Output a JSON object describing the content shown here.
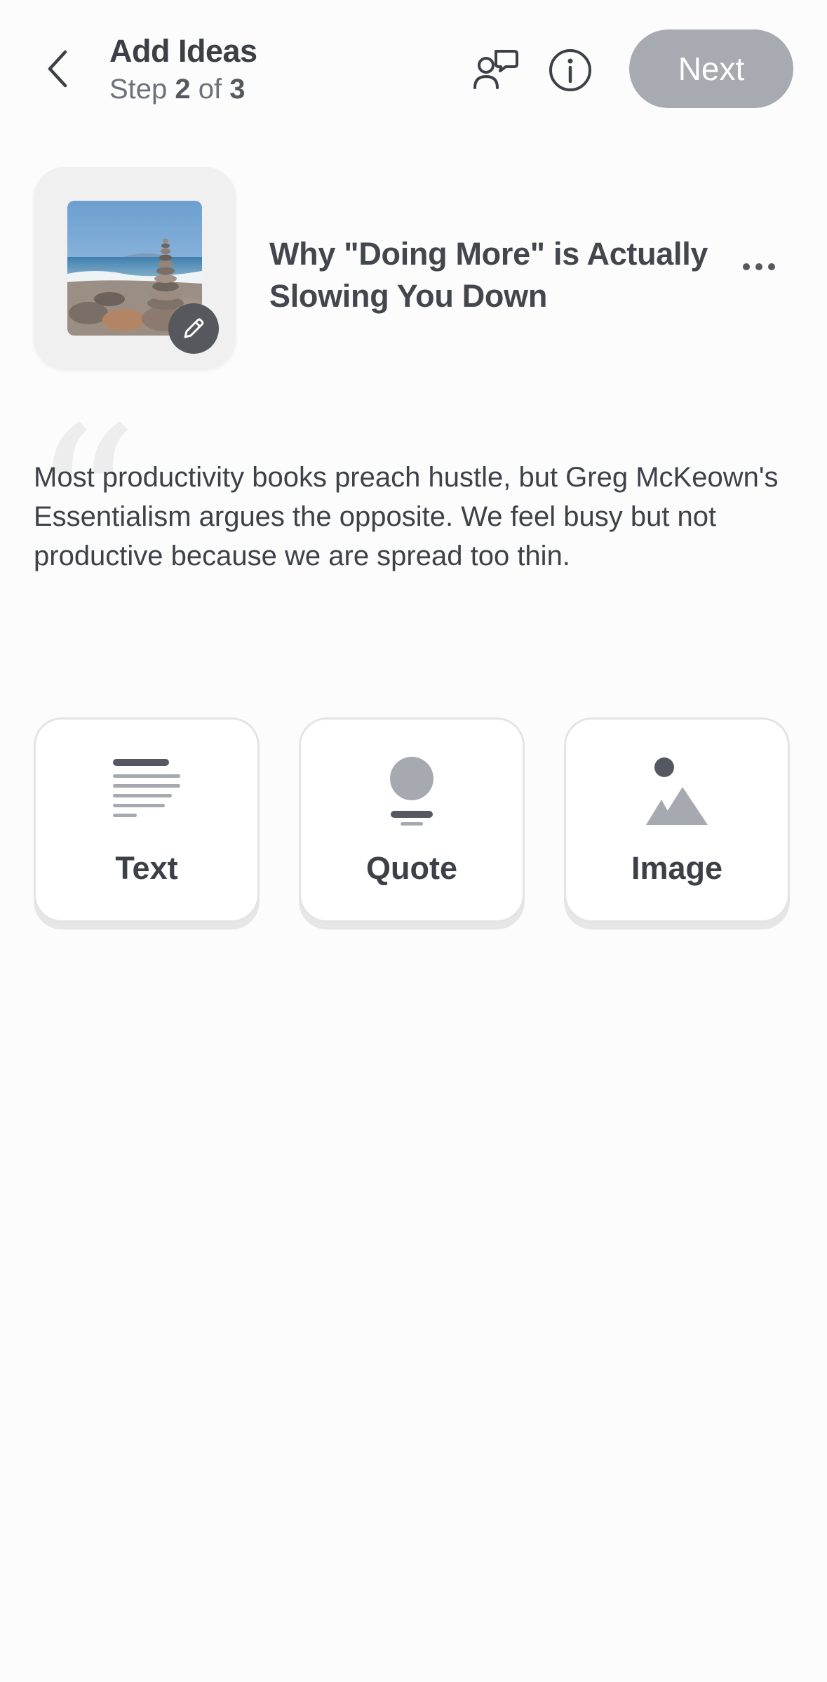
{
  "header": {
    "title": "Add Ideas",
    "step_prefix": "Step ",
    "step_current": "2",
    "step_of": " of ",
    "step_total": "3",
    "next_label": "Next",
    "next_color": "#a7aab1"
  },
  "idea": {
    "title": "Why \"Doing More\" is Actually Slowing You Down",
    "body": "Most productivity books preach hustle, but Greg McKeown's Essentialism argues the opposite. We feel busy but not productive because we are spread too thin."
  },
  "add_options": [
    {
      "label": "Text",
      "icon": "text-lines-icon"
    },
    {
      "label": "Quote",
      "icon": "quote-icon"
    },
    {
      "label": "Image",
      "icon": "image-icon"
    }
  ],
  "icons": {
    "back": "chevron-left-icon",
    "chat": "chat-people-icon",
    "info": "info-icon",
    "more": "more-horizontal-icon",
    "edit": "pencil-icon",
    "quote_mark": "quote-mark-icon"
  }
}
